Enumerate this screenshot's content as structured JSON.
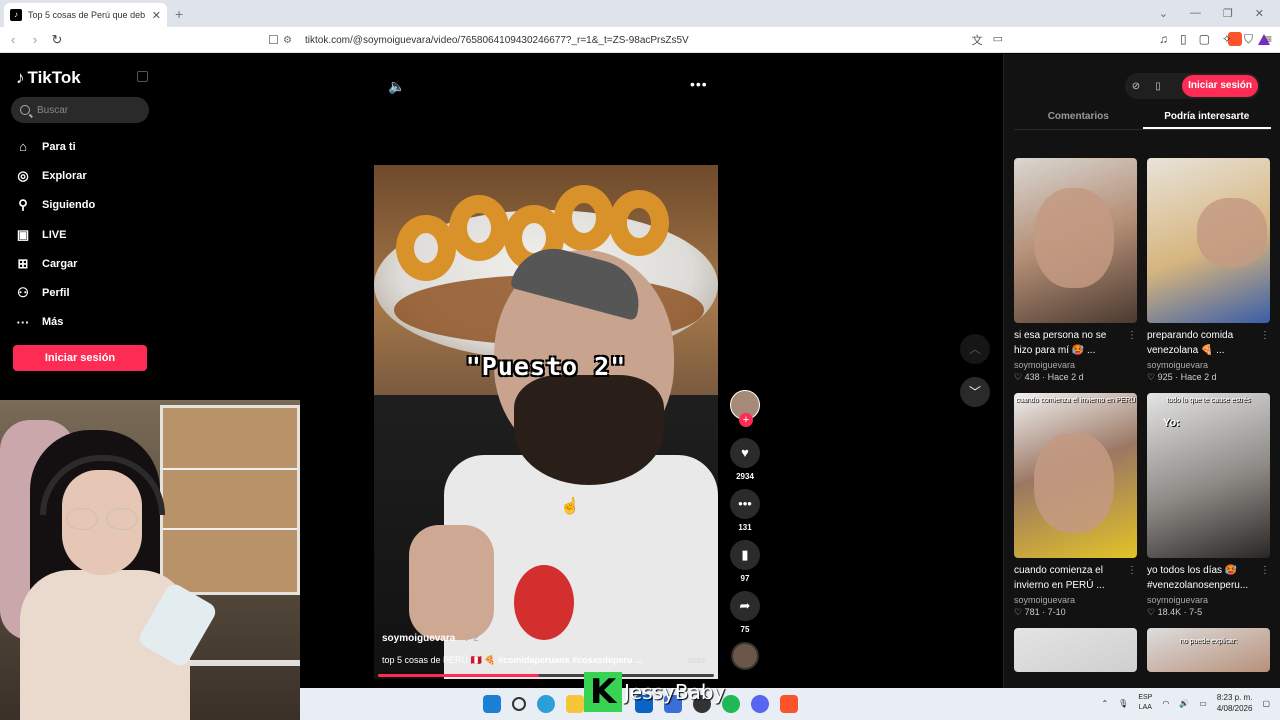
{
  "browser": {
    "tab_title": "Top 5 cosas de Perú que deb",
    "tab_close": "✕",
    "new_tab": "+",
    "url": "tiktok.com/@soymoiguevara/video/7658064109430246677?_r=1&_t=ZS-98acPrsZs5V"
  },
  "sidebar": {
    "logo": "TikTok",
    "search_placeholder": "Buscar",
    "items": [
      {
        "label": "Para ti",
        "icon": "home-icon"
      },
      {
        "label": "Explorar",
        "icon": "compass-icon"
      },
      {
        "label": "Siguiendo",
        "icon": "user-follow-icon"
      },
      {
        "label": "LIVE",
        "icon": "live-icon"
      },
      {
        "label": "Cargar",
        "icon": "upload-icon"
      },
      {
        "label": "Perfil",
        "icon": "profile-icon"
      },
      {
        "label": "Más",
        "icon": "more-icon"
      }
    ],
    "login_label": "Iniciar sesión"
  },
  "video": {
    "overlay_text": "\"Puesto 2\"",
    "username": "soymoiguevara",
    "date": "· 7-2",
    "description_text": "top 5 cosas de PERÚ",
    "description_tags": "#comidaperuana #cosasdeperu ...",
    "more_label": "más",
    "progress": 0.48
  },
  "actions": {
    "likes": "2934",
    "comments": "131",
    "saves": "97",
    "shares": "75"
  },
  "right_panel": {
    "login_label": "Iniciar sesión",
    "tabs": [
      "Comentarios",
      "Podría interesarte"
    ],
    "active_tab": "Podría interesarte",
    "cards": [
      {
        "title": "si esa persona no se hizo para mí 🥵 ...",
        "author": "soymoiguevara",
        "likes": "438",
        "time": "Hace 2 d"
      },
      {
        "title": "preparando comida venezolana 🍕 ...",
        "author": "soymoiguevara",
        "likes": "925",
        "time": "Hace 2 d"
      },
      {
        "title": "cuando comienza el invierno en PERÚ ...",
        "author": "soymoiguevara",
        "likes": "781",
        "time": "7-10",
        "thumb_text": "cuando comienza el invierno en PERÚ"
      },
      {
        "title": "yo todos los días 🥵 #venezolanosenperu...",
        "author": "soymoiguevara",
        "likes": "18.4K",
        "time": "7-5",
        "thumb_text": "todo lo que te cause estrés",
        "thumb_yo": "Yo:"
      },
      {
        "thumb_text": ""
      },
      {
        "thumb_text": "no puede explicar:"
      }
    ]
  },
  "taskbar": {
    "lang_line1": "ESP",
    "lang_line2": "LAA",
    "time": "8:23 p. m.",
    "date": "4/08/2026"
  },
  "watermark": {
    "letter": "K",
    "name": "JessyBaby"
  }
}
